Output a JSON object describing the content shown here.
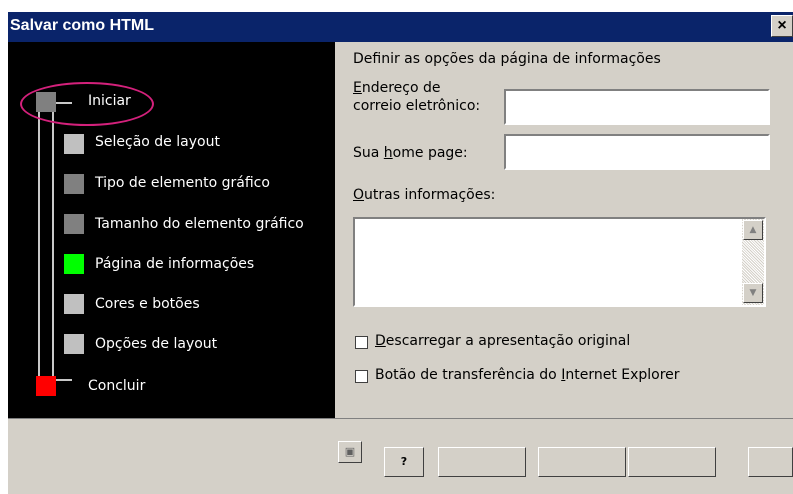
{
  "window": {
    "title": "Salvar como HTML",
    "close_glyph": "×"
  },
  "steps": [
    {
      "label": "Iniciar",
      "color": "#808080"
    },
    {
      "label": "Seleção de layout",
      "color": "#c0c0c0"
    },
    {
      "label": "Tipo de elemento gráfico",
      "color": "#808080"
    },
    {
      "label": "Tamanho do elemento gráfico",
      "color": "#808080"
    },
    {
      "label": "Página de informações",
      "color": "#00ff00"
    },
    {
      "label": "Cores e botões",
      "color": "#c0c0c0"
    },
    {
      "label": "Opções de layout",
      "color": "#c0c0c0"
    },
    {
      "label": "Concluir",
      "color": "#ff0000"
    }
  ],
  "form": {
    "heading": "Definir as opções da página de informações",
    "email_label_a": "E",
    "email_label_b": "ndereço de",
    "email_label_line2": "correio eletrônico:",
    "email_value": "",
    "homepage_label_a": "Sua ",
    "homepage_label_b": "h",
    "homepage_label_c": "ome page:",
    "homepage_value": "",
    "other_label_a": "O",
    "other_label_b": "utras informações:",
    "other_value": "",
    "scroll_up_glyph": "▲",
    "scroll_down_glyph": "▼"
  },
  "options": [
    {
      "a": "",
      "b": "D",
      "c": "escarregar a apresentação original",
      "checked": false
    },
    {
      "a": "Botão de transferência do ",
      "b": "I",
      "c": "nternet Explorer",
      "checked": false
    }
  ],
  "bottom": {
    "help_glyph": "?"
  },
  "colors": {
    "title_bar": "#0a246a",
    "panel_bg": "#000000",
    "dialog_bg": "#d4d0c8",
    "highlight_oval": "#d4217c"
  }
}
